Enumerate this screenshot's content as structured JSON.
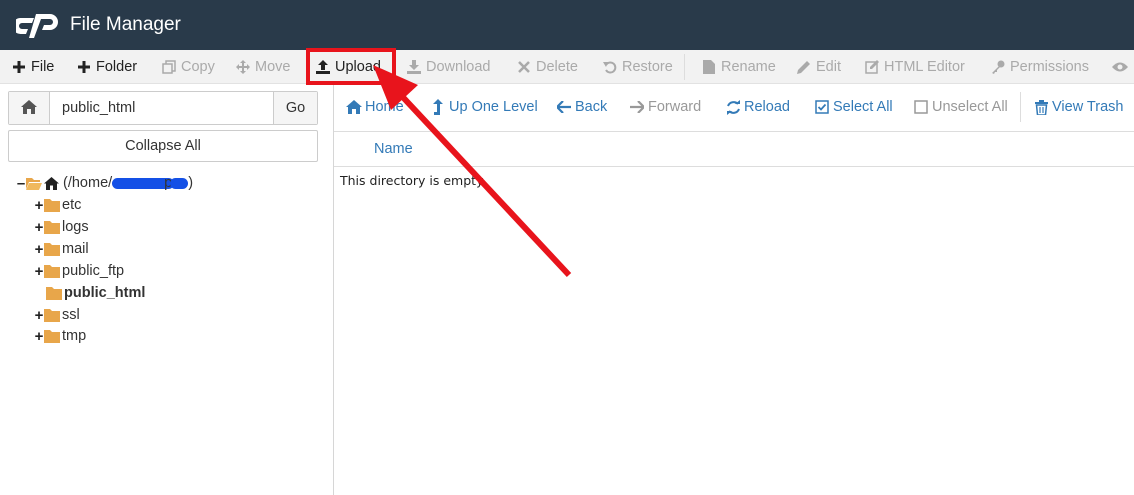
{
  "header": {
    "title": "File Manager",
    "logo": "cpanel-logo"
  },
  "toolbar": {
    "file": "File",
    "folder": "Folder",
    "copy": "Copy",
    "move": "Move",
    "upload": "Upload",
    "download": "Download",
    "delete": "Delete",
    "restore": "Restore",
    "rename": "Rename",
    "edit": "Edit",
    "html_editor": "HTML Editor",
    "permissions": "Permissions"
  },
  "left": {
    "path_value": "public_html",
    "go_label": "Go",
    "collapse_label": "Collapse All",
    "tree": {
      "root_prefix": "(/home/",
      "root_mid": "p",
      "root_suffix": ")",
      "items": [
        "etc",
        "logs",
        "mail",
        "public_ftp",
        "public_html",
        "ssl",
        "tmp"
      ]
    }
  },
  "nav": {
    "home": "Home",
    "up_one_level": "Up One Level",
    "back": "Back",
    "forward": "Forward",
    "reload": "Reload",
    "select_all": "Select All",
    "unselect_all": "Unselect All",
    "view_trash": "View Trash"
  },
  "table": {
    "column_name": "Name",
    "empty_message": "This directory is empty."
  },
  "colors": {
    "header_bg": "#293a4a",
    "link_blue": "#337ab7",
    "folder_orange": "#e8a64a",
    "annotation_red": "#e8141c"
  }
}
